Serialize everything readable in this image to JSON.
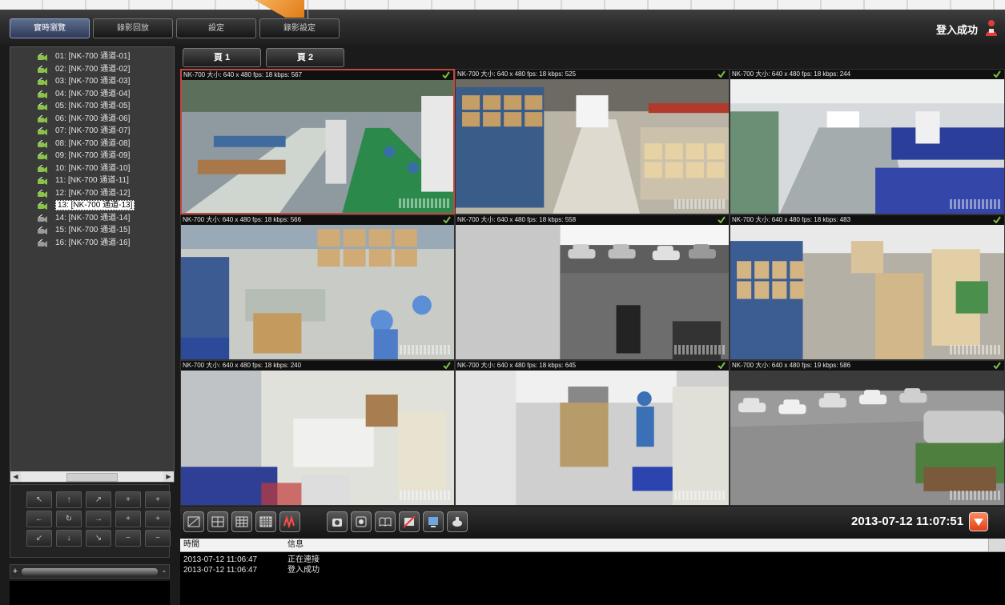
{
  "header": {
    "tabs": [
      {
        "label": "實時瀏覽",
        "active": true
      },
      {
        "label": "錄影回放",
        "active": false
      },
      {
        "label": "設定",
        "active": false
      },
      {
        "label": "錄影設定",
        "active": false
      }
    ],
    "login_status": "登入成功",
    "accent": "#e07c18"
  },
  "channels": [
    {
      "label": "01: [NK-700 通道-01]",
      "online": true
    },
    {
      "label": "02: [NK-700 通道-02]",
      "online": true
    },
    {
      "label": "03: [NK-700 通道-03]",
      "online": true
    },
    {
      "label": "04: [NK-700 通道-04]",
      "online": true
    },
    {
      "label": "05: [NK-700 通道-05]",
      "online": true
    },
    {
      "label": "06: [NK-700 通道-06]",
      "online": true
    },
    {
      "label": "07: [NK-700 通道-07]",
      "online": true
    },
    {
      "label": "08: [NK-700 通道-08]",
      "online": true
    },
    {
      "label": "09: [NK-700 通道-09]",
      "online": true
    },
    {
      "label": "10: [NK-700 通道-10]",
      "online": true
    },
    {
      "label": "11: [NK-700 通道-11]",
      "online": true
    },
    {
      "label": "12: [NK-700 通道-12]",
      "online": true
    },
    {
      "label": "13: [NK-700 通道-13]",
      "online": true,
      "selected": true
    },
    {
      "label": "14: [NK-700 通道-14]",
      "online": false
    },
    {
      "label": "15: [NK-700 通道-15]",
      "online": false
    },
    {
      "label": "16: [NK-700 通道-16]",
      "online": false
    }
  ],
  "ptz": {
    "buttons": [
      "↖",
      "↑",
      "↗",
      "+",
      "+",
      "←",
      "↻",
      "→",
      "+",
      "+",
      "↙",
      "↓",
      "↘",
      "−",
      "−"
    ],
    "slider_minus": "+",
    "slider_plus": "-"
  },
  "pages": [
    "頁 1",
    "頁 2"
  ],
  "cameras": [
    {
      "label": "NK-700 大小: 640 x 480 fps: 18 kbps: 567",
      "scene": "factory-line",
      "active": true
    },
    {
      "label": "NK-700 大小: 640 x 480 fps: 18 kbps: 525",
      "scene": "warehouse"
    },
    {
      "label": "NK-700 大小: 640 x 480 fps: 18 kbps: 244",
      "scene": "office"
    },
    {
      "label": "NK-700 大小: 640 x 480 fps: 18 kbps: 566",
      "scene": "assembly"
    },
    {
      "label": "NK-700 大小: 640 x 480 fps: 18 kbps: 558",
      "scene": "parking-garage"
    },
    {
      "label": "NK-700 大小: 640 x 480 fps: 18 kbps: 483",
      "scene": "storage"
    },
    {
      "label": "NK-700 大小: 640 x 480 fps: 18 kbps: 240",
      "scene": "office-corner"
    },
    {
      "label": "NK-700 大小: 640 x 480 fps: 18 kbps: 645",
      "scene": "workshop"
    },
    {
      "label": "NK-700 大小: 640 x 480 fps: 19 kbps: 586",
      "scene": "parking-lot"
    }
  ],
  "toolbar": {
    "layout_icons": [
      "single-view-icon",
      "quad-view-icon",
      "nine-view-icon",
      "sixteen-view-icon",
      "auto-cycle-icon"
    ],
    "action_icons": [
      "snapshot-icon",
      "record-icon",
      "book-icon",
      "mute-icon",
      "screen-icon",
      "ptz-icon"
    ],
    "datetime": "2013-07-12 11:07:51"
  },
  "log": {
    "columns": [
      "時間",
      "信息"
    ],
    "rows": [
      {
        "time": "2013-07-12 11:06:47",
        "message": "正在連接"
      },
      {
        "time": "2013-07-12 11:06:47",
        "message": "登入成功"
      }
    ]
  }
}
